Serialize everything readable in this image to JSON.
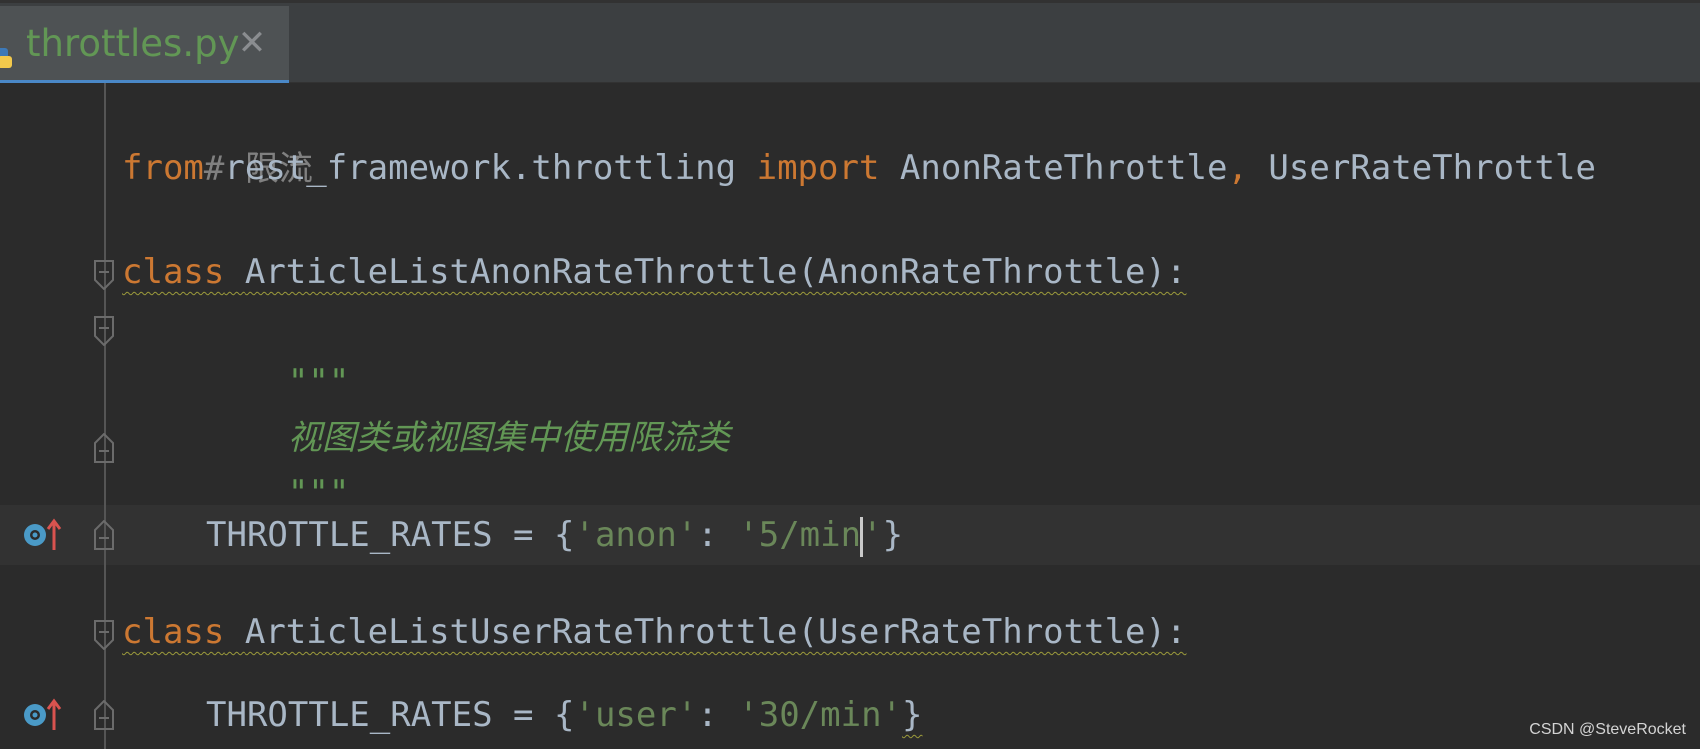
{
  "tab": {
    "label": "throttles.py",
    "close_label": "✕",
    "icon": "python-file-icon"
  },
  "code": {
    "comment": "# 限流",
    "import_line": {
      "from_kw": "from",
      "module": "rest_framework.throttling",
      "import_kw": "import",
      "name1": "AnonRateThrottle",
      "comma": ",",
      "name2": "UserRateThrottle"
    },
    "class1": {
      "kw": "class",
      "signature": "ArticleListAnonRateThrottle(AnonRateThrottle):",
      "doc_open": "\"\"\"",
      "doc_text": "视图类或视图集中使用限流类",
      "doc_close": "\"\"\"",
      "attr": "THROTTLE_RATES",
      "eq": " = {",
      "key": "'anon'",
      "colon": ": ",
      "value_before_caret": "'5/min",
      "value_after_caret": "'",
      "close": "}"
    },
    "class2": {
      "kw": "class",
      "signature": "ArticleListUserRateThrottle(UserRateThrottle):",
      "attr": "THROTTLE_RATES",
      "eq": " = {",
      "key": "'user'",
      "colon": ": ",
      "value": "'30/min'",
      "close": "}"
    }
  },
  "gutter": {
    "override_icon": "override-method-icon",
    "fold_icon": "fold-marker-icon"
  },
  "colors": {
    "background": "#2b2b2b",
    "keyword": "#cc7832",
    "identifier": "#a9b7c6",
    "string": "#6a8759",
    "docstring": "#629755",
    "comment": "#808080",
    "tab_accent": "#4a88c7"
  },
  "watermark": "CSDN @SteveRocket"
}
